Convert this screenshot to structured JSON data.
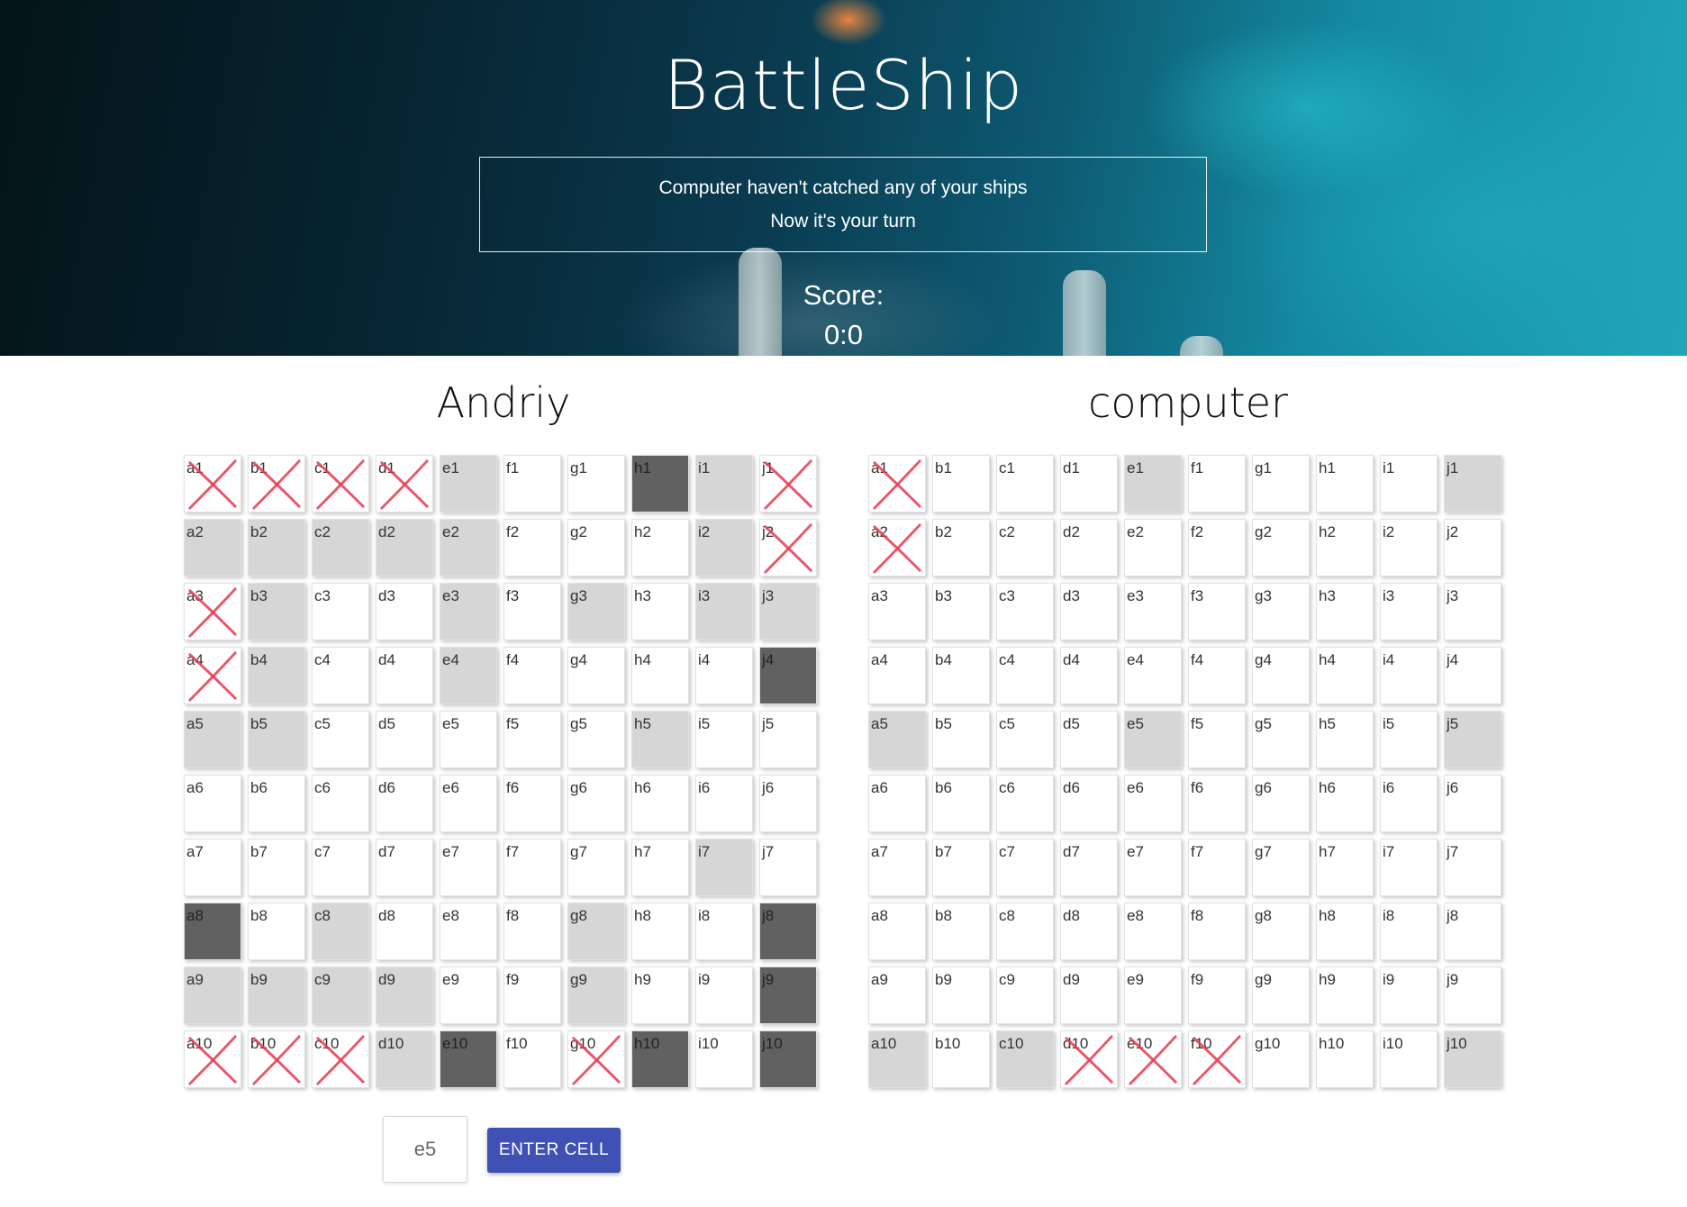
{
  "header": {
    "title": "BattleShip",
    "message_line1": "Computer haven't catched any of your ships",
    "message_line2": "Now it's your turn",
    "score_label": "Score:",
    "score_value": "0:0"
  },
  "boards": [
    {
      "player": "Andriy",
      "rows": [
        [
          {
            "l": "a1",
            "s": "miss"
          },
          {
            "l": "b1",
            "s": "miss"
          },
          {
            "l": "c1",
            "s": "miss"
          },
          {
            "l": "d1",
            "s": "miss"
          },
          {
            "l": "e1",
            "s": "hit"
          },
          {
            "l": "f1",
            "s": ""
          },
          {
            "l": "g1",
            "s": ""
          },
          {
            "l": "h1",
            "s": "ship"
          },
          {
            "l": "i1",
            "s": "hit"
          },
          {
            "l": "j1",
            "s": "miss"
          }
        ],
        [
          {
            "l": "a2",
            "s": "hit"
          },
          {
            "l": "b2",
            "s": "hit"
          },
          {
            "l": "c2",
            "s": "hit"
          },
          {
            "l": "d2",
            "s": "hit"
          },
          {
            "l": "e2",
            "s": "hit"
          },
          {
            "l": "f2",
            "s": ""
          },
          {
            "l": "g2",
            "s": ""
          },
          {
            "l": "h2",
            "s": ""
          },
          {
            "l": "i2",
            "s": "hit"
          },
          {
            "l": "j2",
            "s": "miss"
          }
        ],
        [
          {
            "l": "a3",
            "s": "miss"
          },
          {
            "l": "b3",
            "s": "hit"
          },
          {
            "l": "c3",
            "s": ""
          },
          {
            "l": "d3",
            "s": ""
          },
          {
            "l": "e3",
            "s": "hit"
          },
          {
            "l": "f3",
            "s": ""
          },
          {
            "l": "g3",
            "s": "hit"
          },
          {
            "l": "h3",
            "s": ""
          },
          {
            "l": "i3",
            "s": "hit"
          },
          {
            "l": "j3",
            "s": "hit"
          }
        ],
        [
          {
            "l": "a4",
            "s": "miss"
          },
          {
            "l": "b4",
            "s": "hit"
          },
          {
            "l": "c4",
            "s": ""
          },
          {
            "l": "d4",
            "s": ""
          },
          {
            "l": "e4",
            "s": "hit"
          },
          {
            "l": "f4",
            "s": ""
          },
          {
            "l": "g4",
            "s": ""
          },
          {
            "l": "h4",
            "s": ""
          },
          {
            "l": "i4",
            "s": ""
          },
          {
            "l": "j4",
            "s": "ship"
          }
        ],
        [
          {
            "l": "a5",
            "s": "hit"
          },
          {
            "l": "b5",
            "s": "hit"
          },
          {
            "l": "c5",
            "s": ""
          },
          {
            "l": "d5",
            "s": ""
          },
          {
            "l": "e5",
            "s": ""
          },
          {
            "l": "f5",
            "s": ""
          },
          {
            "l": "g5",
            "s": ""
          },
          {
            "l": "h5",
            "s": "hit"
          },
          {
            "l": "i5",
            "s": ""
          },
          {
            "l": "j5",
            "s": ""
          }
        ],
        [
          {
            "l": "a6",
            "s": ""
          },
          {
            "l": "b6",
            "s": ""
          },
          {
            "l": "c6",
            "s": ""
          },
          {
            "l": "d6",
            "s": ""
          },
          {
            "l": "e6",
            "s": ""
          },
          {
            "l": "f6",
            "s": ""
          },
          {
            "l": "g6",
            "s": ""
          },
          {
            "l": "h6",
            "s": ""
          },
          {
            "l": "i6",
            "s": ""
          },
          {
            "l": "j6",
            "s": ""
          }
        ],
        [
          {
            "l": "a7",
            "s": ""
          },
          {
            "l": "b7",
            "s": ""
          },
          {
            "l": "c7",
            "s": ""
          },
          {
            "l": "d7",
            "s": ""
          },
          {
            "l": "e7",
            "s": ""
          },
          {
            "l": "f7",
            "s": ""
          },
          {
            "l": "g7",
            "s": ""
          },
          {
            "l": "h7",
            "s": ""
          },
          {
            "l": "i7",
            "s": "hit"
          },
          {
            "l": "j7",
            "s": ""
          }
        ],
        [
          {
            "l": "a8",
            "s": "ship"
          },
          {
            "l": "b8",
            "s": ""
          },
          {
            "l": "c8",
            "s": "hit"
          },
          {
            "l": "d8",
            "s": ""
          },
          {
            "l": "e8",
            "s": ""
          },
          {
            "l": "f8",
            "s": ""
          },
          {
            "l": "g8",
            "s": "hit"
          },
          {
            "l": "h8",
            "s": ""
          },
          {
            "l": "i8",
            "s": ""
          },
          {
            "l": "j8",
            "s": "ship"
          }
        ],
        [
          {
            "l": "a9",
            "s": "hit"
          },
          {
            "l": "b9",
            "s": "hit"
          },
          {
            "l": "c9",
            "s": "hit"
          },
          {
            "l": "d9",
            "s": "hit"
          },
          {
            "l": "e9",
            "s": ""
          },
          {
            "l": "f9",
            "s": ""
          },
          {
            "l": "g9",
            "s": "hit"
          },
          {
            "l": "h9",
            "s": ""
          },
          {
            "l": "i9",
            "s": ""
          },
          {
            "l": "j9",
            "s": "ship"
          }
        ],
        [
          {
            "l": "a10",
            "s": "miss"
          },
          {
            "l": "b10",
            "s": "miss"
          },
          {
            "l": "c10",
            "s": "miss"
          },
          {
            "l": "d10",
            "s": "hit"
          },
          {
            "l": "e10",
            "s": "ship"
          },
          {
            "l": "f10",
            "s": ""
          },
          {
            "l": "g10",
            "s": "miss"
          },
          {
            "l": "h10",
            "s": "ship"
          },
          {
            "l": "i10",
            "s": ""
          },
          {
            "l": "j10",
            "s": "ship"
          }
        ]
      ]
    },
    {
      "player": "computer",
      "rows": [
        [
          {
            "l": "a1",
            "s": "miss"
          },
          {
            "l": "b1",
            "s": ""
          },
          {
            "l": "c1",
            "s": ""
          },
          {
            "l": "d1",
            "s": ""
          },
          {
            "l": "e1",
            "s": "hit"
          },
          {
            "l": "f1",
            "s": ""
          },
          {
            "l": "g1",
            "s": ""
          },
          {
            "l": "h1",
            "s": ""
          },
          {
            "l": "i1",
            "s": ""
          },
          {
            "l": "j1",
            "s": "hit"
          }
        ],
        [
          {
            "l": "a2",
            "s": "miss"
          },
          {
            "l": "b2",
            "s": ""
          },
          {
            "l": "c2",
            "s": ""
          },
          {
            "l": "d2",
            "s": ""
          },
          {
            "l": "e2",
            "s": ""
          },
          {
            "l": "f2",
            "s": ""
          },
          {
            "l": "g2",
            "s": ""
          },
          {
            "l": "h2",
            "s": ""
          },
          {
            "l": "i2",
            "s": ""
          },
          {
            "l": "j2",
            "s": ""
          }
        ],
        [
          {
            "l": "a3",
            "s": ""
          },
          {
            "l": "b3",
            "s": ""
          },
          {
            "l": "c3",
            "s": ""
          },
          {
            "l": "d3",
            "s": ""
          },
          {
            "l": "e3",
            "s": ""
          },
          {
            "l": "f3",
            "s": ""
          },
          {
            "l": "g3",
            "s": ""
          },
          {
            "l": "h3",
            "s": ""
          },
          {
            "l": "i3",
            "s": ""
          },
          {
            "l": "j3",
            "s": ""
          }
        ],
        [
          {
            "l": "a4",
            "s": ""
          },
          {
            "l": "b4",
            "s": ""
          },
          {
            "l": "c4",
            "s": ""
          },
          {
            "l": "d4",
            "s": ""
          },
          {
            "l": "e4",
            "s": ""
          },
          {
            "l": "f4",
            "s": ""
          },
          {
            "l": "g4",
            "s": ""
          },
          {
            "l": "h4",
            "s": ""
          },
          {
            "l": "i4",
            "s": ""
          },
          {
            "l": "j4",
            "s": ""
          }
        ],
        [
          {
            "l": "a5",
            "s": "hit"
          },
          {
            "l": "b5",
            "s": ""
          },
          {
            "l": "c5",
            "s": ""
          },
          {
            "l": "d5",
            "s": ""
          },
          {
            "l": "e5",
            "s": "hit"
          },
          {
            "l": "f5",
            "s": ""
          },
          {
            "l": "g5",
            "s": ""
          },
          {
            "l": "h5",
            "s": ""
          },
          {
            "l": "i5",
            "s": ""
          },
          {
            "l": "j5",
            "s": "hit"
          }
        ],
        [
          {
            "l": "a6",
            "s": ""
          },
          {
            "l": "b6",
            "s": ""
          },
          {
            "l": "c6",
            "s": ""
          },
          {
            "l": "d6",
            "s": ""
          },
          {
            "l": "e6",
            "s": ""
          },
          {
            "l": "f6",
            "s": ""
          },
          {
            "l": "g6",
            "s": ""
          },
          {
            "l": "h6",
            "s": ""
          },
          {
            "l": "i6",
            "s": ""
          },
          {
            "l": "j6",
            "s": ""
          }
        ],
        [
          {
            "l": "a7",
            "s": ""
          },
          {
            "l": "b7",
            "s": ""
          },
          {
            "l": "c7",
            "s": ""
          },
          {
            "l": "d7",
            "s": ""
          },
          {
            "l": "e7",
            "s": ""
          },
          {
            "l": "f7",
            "s": ""
          },
          {
            "l": "g7",
            "s": ""
          },
          {
            "l": "h7",
            "s": ""
          },
          {
            "l": "i7",
            "s": ""
          },
          {
            "l": "j7",
            "s": ""
          }
        ],
        [
          {
            "l": "a8",
            "s": ""
          },
          {
            "l": "b8",
            "s": ""
          },
          {
            "l": "c8",
            "s": ""
          },
          {
            "l": "d8",
            "s": ""
          },
          {
            "l": "e8",
            "s": ""
          },
          {
            "l": "f8",
            "s": ""
          },
          {
            "l": "g8",
            "s": ""
          },
          {
            "l": "h8",
            "s": ""
          },
          {
            "l": "i8",
            "s": ""
          },
          {
            "l": "j8",
            "s": ""
          }
        ],
        [
          {
            "l": "a9",
            "s": ""
          },
          {
            "l": "b9",
            "s": ""
          },
          {
            "l": "c9",
            "s": ""
          },
          {
            "l": "d9",
            "s": ""
          },
          {
            "l": "e9",
            "s": ""
          },
          {
            "l": "f9",
            "s": ""
          },
          {
            "l": "g9",
            "s": ""
          },
          {
            "l": "h9",
            "s": ""
          },
          {
            "l": "i9",
            "s": ""
          },
          {
            "l": "j9",
            "s": ""
          }
        ],
        [
          {
            "l": "a10",
            "s": "hit"
          },
          {
            "l": "b10",
            "s": ""
          },
          {
            "l": "c10",
            "s": "hit"
          },
          {
            "l": "d10",
            "s": "miss"
          },
          {
            "l": "e10",
            "s": "miss"
          },
          {
            "l": "f10",
            "s": "miss"
          },
          {
            "l": "g10",
            "s": ""
          },
          {
            "l": "h10",
            "s": ""
          },
          {
            "l": "i10",
            "s": ""
          },
          {
            "l": "j10",
            "s": "hit"
          }
        ]
      ]
    }
  ],
  "controls": {
    "cell_input_value": "e5",
    "enter_button_label": "ENTER CELL"
  },
  "colors": {
    "accent": "#3f51b5",
    "hit_cell": "#d6d6d6",
    "ship_cell": "#616161",
    "miss_mark": "#e8384f"
  }
}
